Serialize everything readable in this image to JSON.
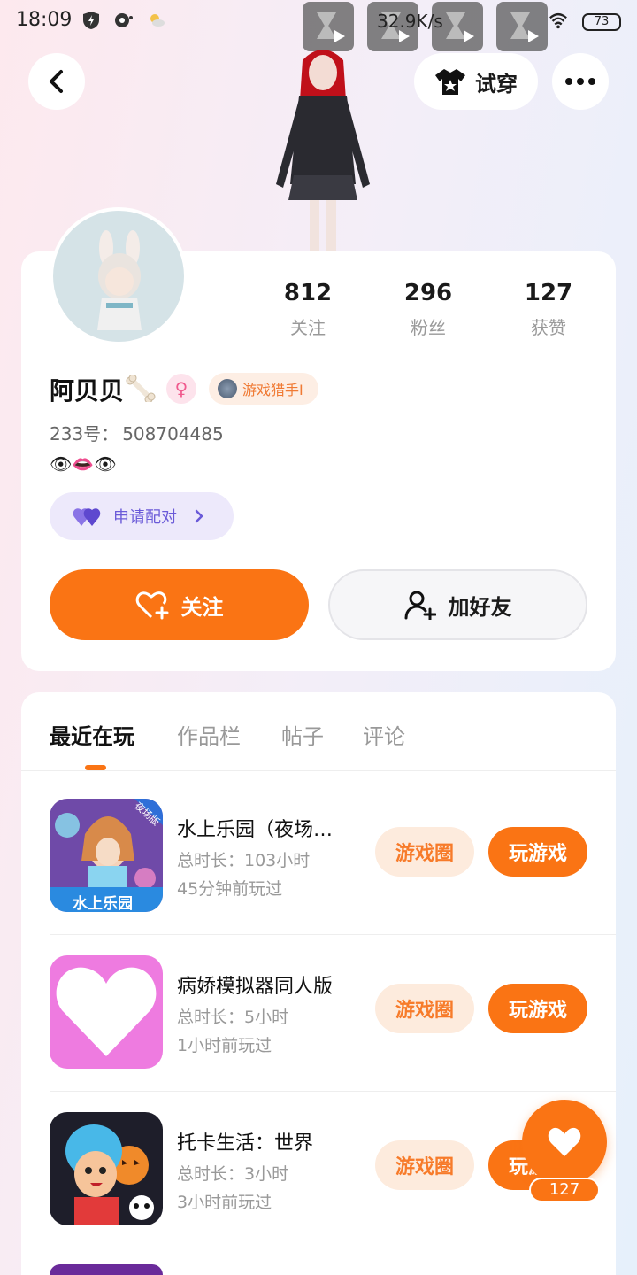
{
  "status_bar": {
    "time": "18:09",
    "net_speed": "32.9K/s",
    "battery": "73"
  },
  "header": {
    "try_on_label": "试穿"
  },
  "profile": {
    "stats": [
      {
        "value": "812",
        "label": "关注"
      },
      {
        "value": "296",
        "label": "粉丝"
      },
      {
        "value": "127",
        "label": "获赞"
      }
    ],
    "username": "阿贝贝",
    "title_badge": "游戏猎手I",
    "uid_label": "233号：",
    "uid_value": "508704485",
    "bio": "👁👄👁",
    "pair_label": "申请配对",
    "follow_label": "关注",
    "add_friend_label": "加好友"
  },
  "tabs": [
    "最近在玩",
    "作品栏",
    "帖子",
    "评论"
  ],
  "games": [
    {
      "name": "水上乐园（夜场版）",
      "icon_label": "水上乐园",
      "icon_corner": "夜场版",
      "total_time": "总时长：103小时",
      "last_played": "45分钟前玩过",
      "circle_label": "游戏圈",
      "play_label": "玩游戏"
    },
    {
      "name": "病娇模拟器同人版",
      "total_time": "总时长：5小时",
      "last_played": "1小时前玩过",
      "circle_label": "游戏圈",
      "play_label": "玩游戏"
    },
    {
      "name": "托卡生活：世界",
      "total_time": "总时长：3小时",
      "last_played": "3小时前玩过",
      "circle_label": "游戏圈",
      "play_label": "玩游戏"
    }
  ],
  "like_fab": {
    "count": "127"
  },
  "colors": {
    "accent": "#fa7414",
    "accent_light": "#fdebdd",
    "pair_purple": "#6a5ad8"
  }
}
